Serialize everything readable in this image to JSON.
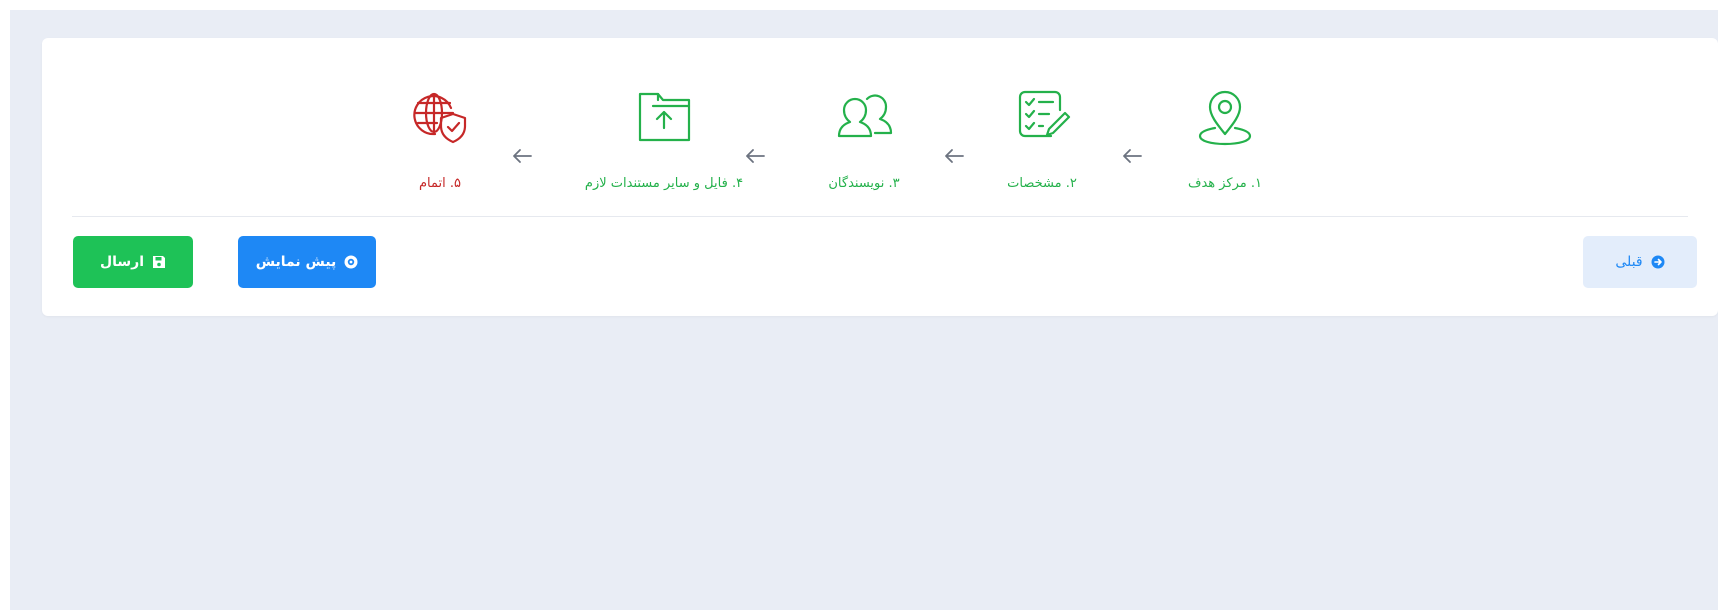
{
  "steps": [
    {
      "label": "۱. مرکز هدف",
      "icon": "map-pin-icon",
      "state": "done",
      "color": "#24b14b"
    },
    {
      "label": "۲. مشخصات",
      "icon": "checklist-edit-icon",
      "state": "done",
      "color": "#24b14b"
    },
    {
      "label": "۳. نویسندگان",
      "icon": "users-icon",
      "state": "done",
      "color": "#24b14b"
    },
    {
      "label": "۴. فایل و سایر مستندات لازم",
      "icon": "folder-upload-icon",
      "state": "done",
      "color": "#24b14b"
    },
    {
      "label": "۵. اتمام",
      "icon": "globe-shield-icon",
      "state": "current",
      "color": "#c62828"
    }
  ],
  "arrow_icon": "arrow-left-icon",
  "buttons": {
    "send_label": "ارسال",
    "send_icon": "save-icon",
    "preview_label": "پیش نمایش",
    "preview_icon": "eye-icon",
    "prev_label": "قبلی",
    "prev_icon": "circle-arrow-icon"
  },
  "colors": {
    "success": "#24b14b",
    "danger": "#c62828",
    "primary": "#1e88f5",
    "send_button": "#1ec257",
    "background": "#e9edf5"
  }
}
